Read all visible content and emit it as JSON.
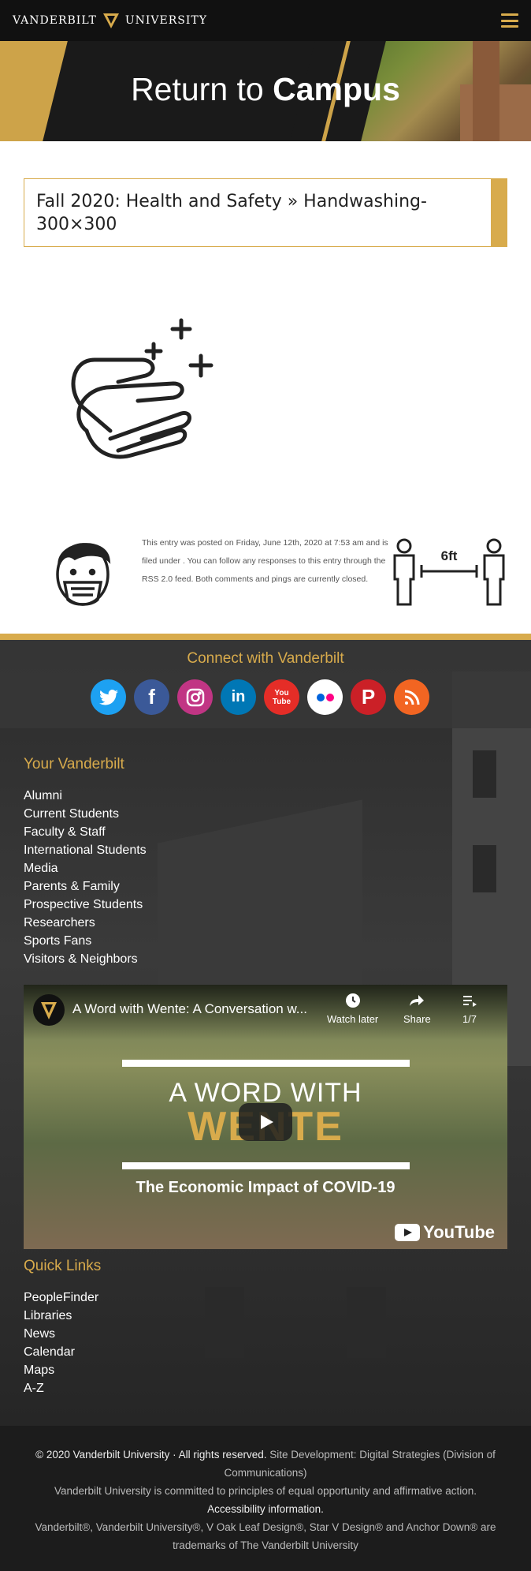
{
  "header": {
    "logo_left": "VANDERBILT",
    "logo_right": "UNIVERSITY",
    "menu_icon": "hamburger-icon"
  },
  "hero": {
    "title_light": "Return to",
    "title_bold": "Campus"
  },
  "page": {
    "title": "Fall 2020: Health and Safety » Handwashing-300×300"
  },
  "entry": {
    "meta": "This entry was posted on Friday, June 12th, 2020 at 7:53 am and is filed under . You can follow any responses to this entry through the RSS 2.0 feed. Both comments and pings are currently closed.",
    "distance_label": "6ft"
  },
  "connect": {
    "title": "Connect with Vanderbilt",
    "socials": [
      {
        "name": "twitter",
        "color": "#1da1f2"
      },
      {
        "name": "facebook",
        "color": "#3b5998"
      },
      {
        "name": "instagram",
        "color": "#c13584"
      },
      {
        "name": "linkedin",
        "color": "#0077b5"
      },
      {
        "name": "youtube",
        "color": "#e52d27",
        "label": "You Tube"
      },
      {
        "name": "flickr",
        "color": "#ffffff"
      },
      {
        "name": "pinterest",
        "color": "#cb2027"
      },
      {
        "name": "rss",
        "color": "#f26522"
      }
    ]
  },
  "your_vanderbilt": {
    "title": "Your Vanderbilt",
    "links": [
      "Alumni",
      "Current Students",
      "Faculty & Staff",
      "International Students",
      "Media",
      "Parents & Family",
      "Prospective Students",
      "Researchers",
      "Sports Fans",
      "Visitors & Neighbors"
    ]
  },
  "video": {
    "title": "A Word with Wente: A Conversation w...",
    "watch_later": "Watch later",
    "share": "Share",
    "playlist_pos": "1/7",
    "overlay_line1": "A WORD WITH",
    "overlay_line2": "WENTE",
    "overlay_sub": "The Economic Impact of COVID-19",
    "brand": "YouTube"
  },
  "quick_links": {
    "title": "Quick Links",
    "links": [
      "PeopleFinder",
      "Libraries",
      "News",
      "Calendar",
      "Maps",
      "A-Z"
    ]
  },
  "footer": {
    "copyright": "© 2020 Vanderbilt University · All rights reserved.",
    "site_dev": "Site Development: Digital Strategies (Division of Communications)",
    "equal_opp": "Vanderbilt University is committed to principles of equal opportunity and affirmative action.",
    "accessibility": "Accessibility information.",
    "trademarks": "Vanderbilt®, Vanderbilt University®, V Oak Leaf Design®, Star V Design® and Anchor Down® are trademarks of The Vanderbilt University"
  }
}
